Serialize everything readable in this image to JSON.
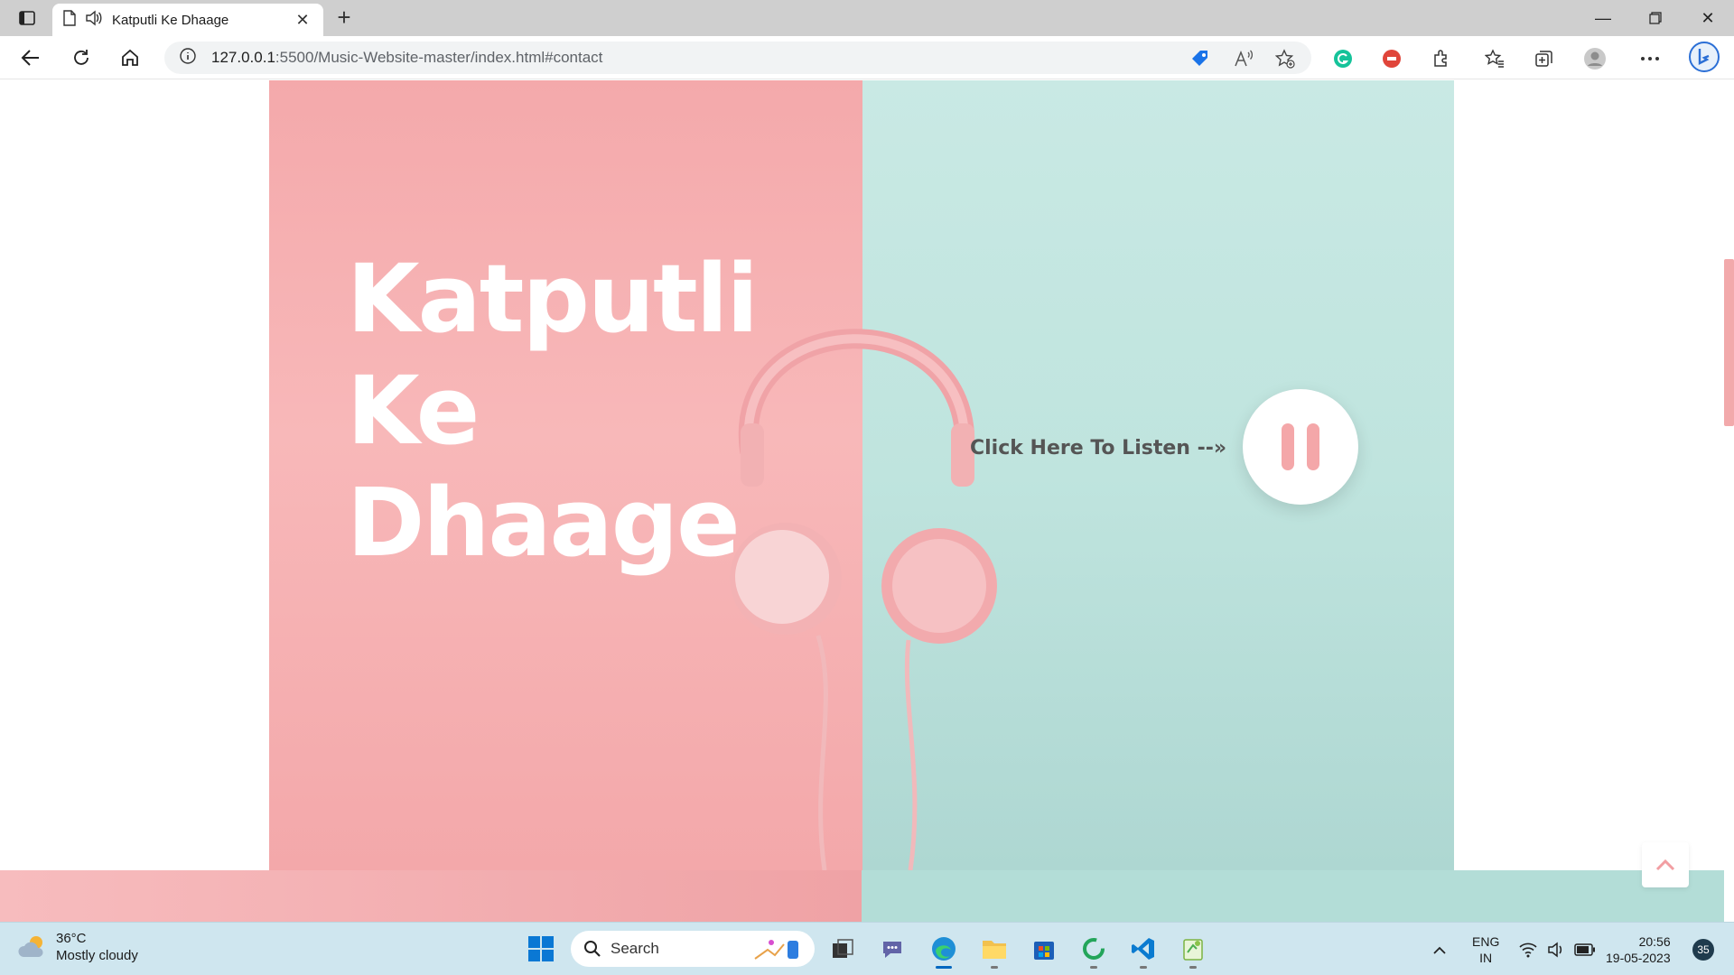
{
  "browser": {
    "tab_title": "Katputli Ke Dhaage",
    "url_host": "127.0.0.1",
    "url_rest": ":5500/Music-Website-master/index.html#contact"
  },
  "hero": {
    "title_line1": "Katputli",
    "title_line2": "Ke",
    "title_line3": "Dhaage",
    "listen_label": "Click Here To Listen --»",
    "player_state": "playing",
    "colors": {
      "pink": "#f8b8b9",
      "mint": "#c1e5df",
      "accent": "#f4a7a9"
    }
  },
  "taskbar": {
    "weather_temp": "36°C",
    "weather_desc": "Mostly cloudy",
    "search_label": "Search",
    "lang_line1": "ENG",
    "lang_line2": "IN",
    "time": "20:56",
    "date": "19-05-2023",
    "notification_count": "35"
  },
  "icons": {
    "tab_actions": "tab-actions-icon",
    "page": "page-icon",
    "audio": "speaker-icon",
    "back": "back-arrow-icon",
    "refresh": "refresh-icon",
    "home": "home-icon",
    "info": "info-icon"
  }
}
